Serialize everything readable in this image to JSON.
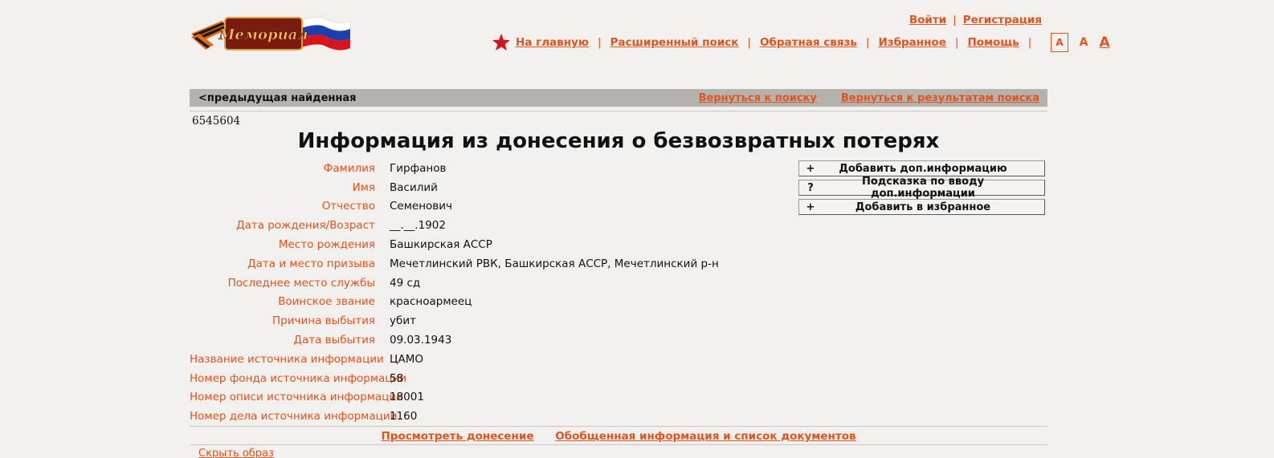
{
  "header": {
    "logo_text": "Мемориал",
    "auth": {
      "login": "Войти",
      "register": "Регистрация"
    },
    "nav": [
      {
        "label": "На главную"
      },
      {
        "label": "Расширенный поиск"
      },
      {
        "label": "Обратная связь"
      },
      {
        "label": "Избранное"
      },
      {
        "label": "Помощь"
      }
    ],
    "separator": "|",
    "font_sizes": [
      "A",
      "A",
      "A"
    ],
    "star_icon": "red-star-icon"
  },
  "backbar": {
    "prev": "<предыдущая найденная",
    "back_to_search": "Вернуться к поиску",
    "back_to_results": "Вернуться к результатам поиска"
  },
  "record_id": "6545604",
  "title": "Информация из донесения о безвозвратных потерях",
  "fields": [
    {
      "label": "Фамилия",
      "value": "Гирфанов"
    },
    {
      "label": "Имя",
      "value": "Василий"
    },
    {
      "label": "Отчество",
      "value": "Семенович"
    },
    {
      "label": "Дата рождения/Возраст",
      "value": "__.__.1902"
    },
    {
      "label": "Место рождения",
      "value": "Башкирская АССР"
    },
    {
      "label": "Дата и место призыва",
      "value": "Мечетлинский РВК, Башкирская АССР, Мечетлинский р-н"
    },
    {
      "label": "Последнее место службы",
      "value": "49 сд"
    },
    {
      "label": "Воинское звание",
      "value": "красноармеец"
    },
    {
      "label": "Причина выбытия",
      "value": "убит"
    },
    {
      "label": "Дата выбытия",
      "value": "09.03.1943"
    },
    {
      "label": "Название источника информации",
      "value": "ЦАМО"
    },
    {
      "label": "Номер фонда источника информации",
      "value": "58"
    },
    {
      "label": "Номер описи источника информации",
      "value": "18001"
    },
    {
      "label": "Номер дела источника информации",
      "value": "1160"
    }
  ],
  "actions": [
    {
      "icon": "+",
      "label": "Добавить доп.информацию"
    },
    {
      "icon": "?",
      "label": "Подсказка по вводу доп.информации"
    },
    {
      "icon": "+",
      "label": "Добавить в избранное"
    }
  ],
  "bottom_links": {
    "view_report": "Просмотреть донесение",
    "summary": "Обобщенная информация и список документов"
  },
  "cut_link": "Скрыть образ",
  "colors": {
    "accent": "#e0541d",
    "background": "#f1f0ee",
    "bar": "#b5b2ae"
  }
}
